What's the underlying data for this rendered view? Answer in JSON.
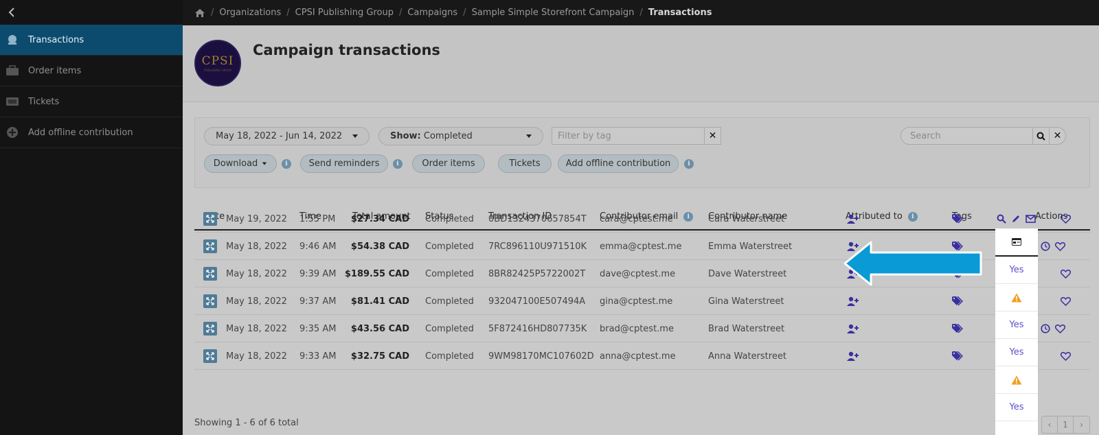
{
  "sidebar": {
    "items": [
      {
        "label": "Transactions",
        "icon": "money-bag-icon"
      },
      {
        "label": "Order items",
        "icon": "bag-icon"
      },
      {
        "label": "Tickets",
        "icon": "ticket-icon"
      },
      {
        "label": "Add offline contribution",
        "icon": "plus-circle-icon"
      }
    ]
  },
  "breadcrumb": {
    "items": [
      "Organizations",
      "CPSI Publishing Group",
      "Campaigns",
      "Sample Simple Storefront Campaign"
    ],
    "current": "Transactions"
  },
  "header": {
    "title": "Campaign transactions",
    "logo_text": "CPSI",
    "logo_sub": "PUBLISHING GROUP"
  },
  "filters": {
    "date_range": "May 18, 2022 - Jun 14, 2022",
    "show_label": "Show:",
    "show_value": "Completed",
    "tag_placeholder": "Filter by tag",
    "search_placeholder": "Search",
    "buttons": {
      "download": "Download",
      "send_reminders": "Send reminders",
      "order_items": "Order items",
      "tickets": "Tickets",
      "add_offline": "Add offline contribution"
    }
  },
  "table": {
    "columns": {
      "date": "Date",
      "time": "Time",
      "amount": "Total amount",
      "status": "Status",
      "txid": "Transaction ID",
      "email": "Contributor email",
      "name": "Contributor name",
      "attributed": "Attributed to",
      "tags": "Tags",
      "actions": "Actions"
    },
    "rows": [
      {
        "date": "May 19, 2022",
        "time": "1:55 PM",
        "amount": "$27.34 CAD",
        "status": "Completed",
        "txid": "0BD1324370657854T",
        "email": "cara@cptest.me",
        "name": "Cara Waterstreet",
        "flag": "Yes",
        "reminder": false
      },
      {
        "date": "May 18, 2022",
        "time": "9:46 AM",
        "amount": "$54.38 CAD",
        "status": "Completed",
        "txid": "7RC896110U971510K",
        "email": "emma@cptest.me",
        "name": "Emma Waterstreet",
        "flag": "",
        "reminder": true
      },
      {
        "date": "May 18, 2022",
        "time": "9:39 AM",
        "amount": "$189.55 CAD",
        "status": "Completed",
        "txid": "8BR82425P5722002T",
        "email": "dave@cptest.me",
        "name": "Dave Waterstreet",
        "flag": "Yes",
        "reminder": false
      },
      {
        "date": "May 18, 2022",
        "time": "9:37 AM",
        "amount": "$81.41 CAD",
        "status": "Completed",
        "txid": "932047100E507494A",
        "email": "gina@cptest.me",
        "name": "Gina Waterstreet",
        "flag": "Yes",
        "reminder": false
      },
      {
        "date": "May 18, 2022",
        "time": "9:35 AM",
        "amount": "$43.56 CAD",
        "status": "Completed",
        "txid": "5F872416HD807735K",
        "email": "brad@cptest.me",
        "name": "Brad Waterstreet",
        "flag": "",
        "reminder": true
      },
      {
        "date": "May 18, 2022",
        "time": "9:33 AM",
        "amount": "$32.75 CAD",
        "status": "Completed",
        "txid": "9WM98170MC107602D",
        "email": "anna@cptest.me",
        "name": "Anna Waterstreet",
        "flag": "Yes",
        "reminder": false
      }
    ]
  },
  "footer": {
    "showing": "Showing 1 - 6 of 6 total",
    "page": "1"
  },
  "colors": {
    "accent": "#0d4b6e",
    "arrow": "#0a9ad6",
    "warning": "#f0a020",
    "link": "#5a4fc8",
    "icon": "#3a2fa0"
  }
}
